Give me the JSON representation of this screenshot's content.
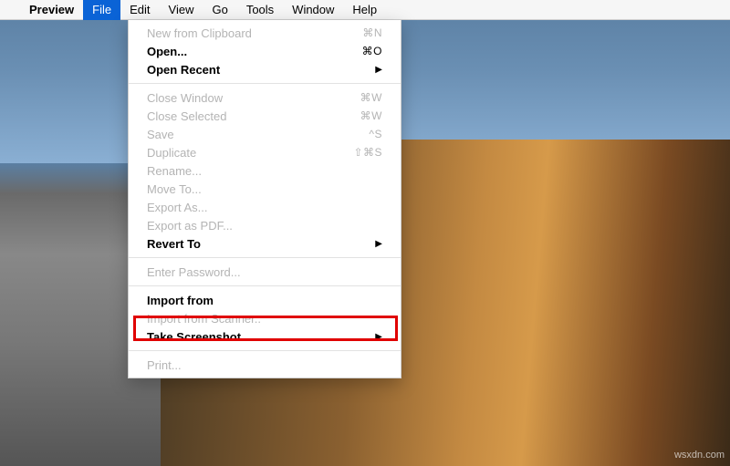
{
  "menubar": {
    "app_name": "Preview",
    "items": [
      "File",
      "Edit",
      "View",
      "Go",
      "Tools",
      "Window",
      "Help"
    ],
    "open_index": 0
  },
  "file_menu": {
    "groups": [
      [
        {
          "label": "New from Clipboard",
          "shortcut": "⌘N",
          "disabled": true
        },
        {
          "label": "Open...",
          "shortcut": "⌘O",
          "bold": true
        },
        {
          "label": "Open Recent",
          "submenu": true,
          "bold": true
        }
      ],
      [
        {
          "label": "Close Window",
          "shortcut": "⌘W",
          "disabled": true
        },
        {
          "label": "Close Selected",
          "shortcut": "⌘W",
          "disabled": true
        },
        {
          "label": "Save",
          "shortcut": "^S",
          "disabled": true
        },
        {
          "label": "Duplicate",
          "shortcut": "⇧⌘S",
          "disabled": true
        },
        {
          "label": "Rename...",
          "disabled": true
        },
        {
          "label": "Move To...",
          "disabled": true
        },
        {
          "label": "Export As...",
          "disabled": true
        },
        {
          "label": "Export as PDF...",
          "disabled": true
        },
        {
          "label": "Revert To",
          "submenu": true,
          "bold": true
        }
      ],
      [
        {
          "label": "Enter Password...",
          "disabled": true
        }
      ],
      [
        {
          "label": "Import from",
          "highlighted": true,
          "bold": true
        },
        {
          "label": "Import from Scanner..",
          "disabled": true
        },
        {
          "label": "Take Screenshot",
          "submenu": true,
          "bold": true
        }
      ],
      [
        {
          "label": "Print...",
          "disabled": true
        }
      ]
    ]
  },
  "watermark": "wsxdn.com"
}
